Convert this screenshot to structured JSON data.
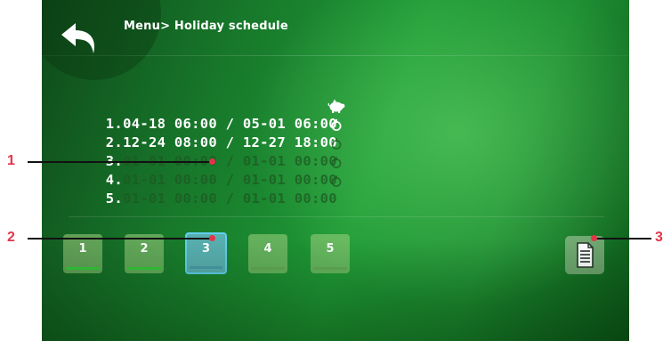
{
  "header": {
    "breadcrumb": "Menu> Holiday schedule"
  },
  "schedule": [
    {
      "index": "1.",
      "period": "04-18 06:00 / 05-01 06:00",
      "mode": "economy-piggy-icon",
      "active": true
    },
    {
      "index": "2.",
      "period": "12-24 08:00 / 12-27 18:00",
      "mode": "standby-icon",
      "active": true
    },
    {
      "index": "3.",
      "period": "01-01 00:00 / 01-01 00:00",
      "mode": "standby-icon",
      "active": false
    },
    {
      "index": "4.",
      "period": "01-01 00:00 / 01-01 00:00",
      "mode": "standby-icon",
      "active": false
    },
    {
      "index": "5.",
      "period": "01-01 00:00 / 01-01 00:00",
      "mode": "standby-icon",
      "active": false
    }
  ],
  "slots": [
    {
      "label": "1",
      "used": true,
      "selected": false
    },
    {
      "label": "2",
      "used": true,
      "selected": false
    },
    {
      "label": "3",
      "used": false,
      "selected": true
    },
    {
      "label": "4",
      "used": false,
      "selected": false
    },
    {
      "label": "5",
      "used": false,
      "selected": false
    }
  ],
  "callouts": [
    "1",
    "2",
    "3"
  ],
  "colors": {
    "accent_selected": "#5fd0ee",
    "slot_used_bar": "#34c83a",
    "callout_red": "#e2354a"
  }
}
